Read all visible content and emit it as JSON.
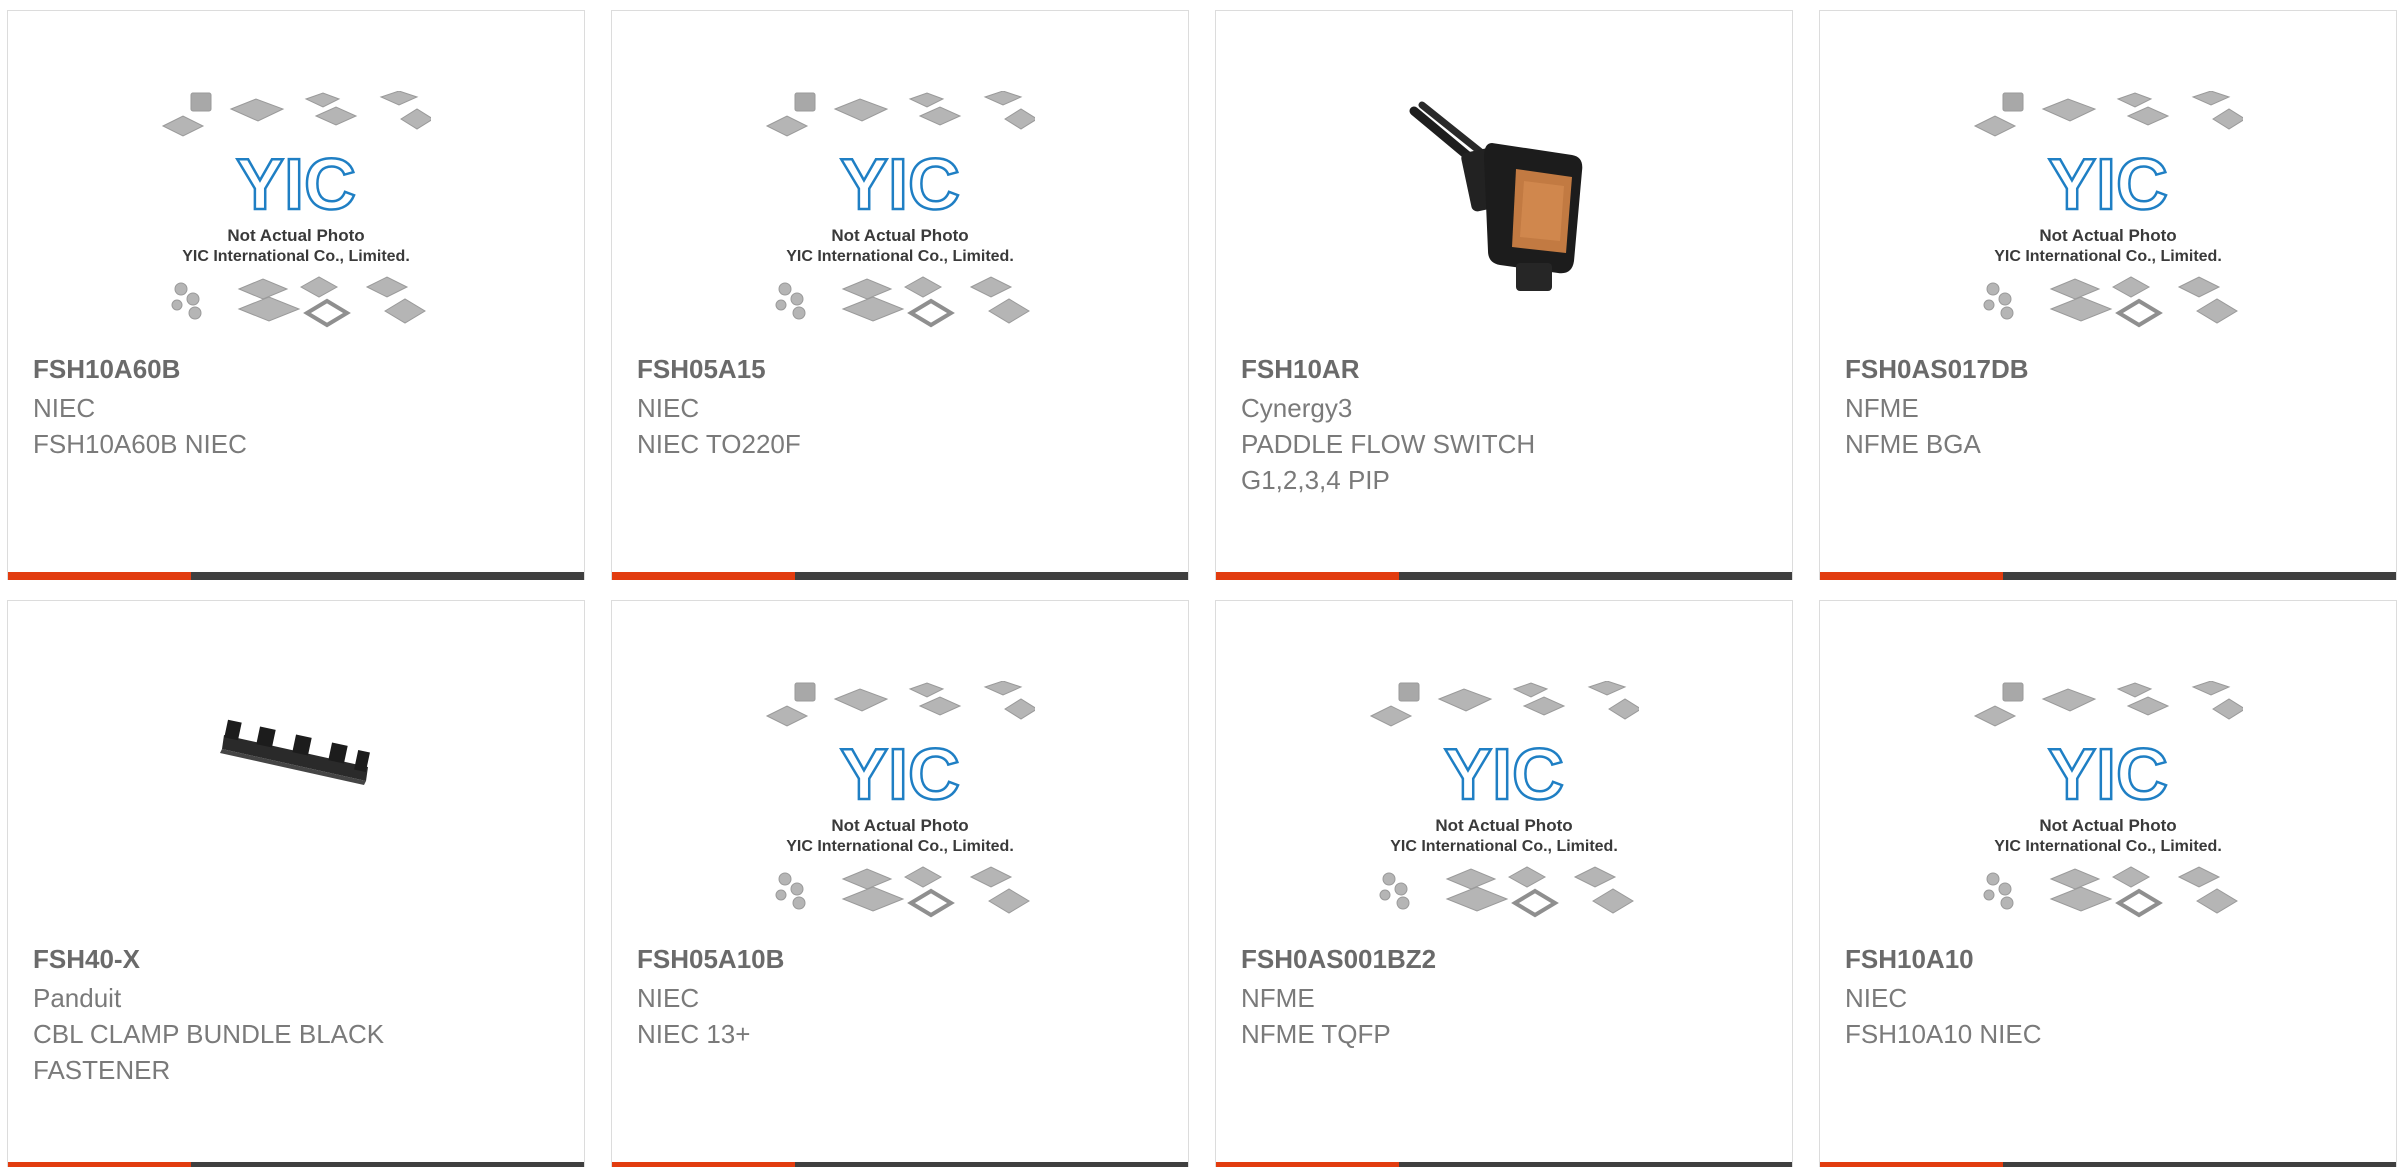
{
  "placeholder": {
    "logo": "YIC",
    "line1": "Not Actual Photo",
    "line2": "YIC International Co., Limited."
  },
  "colors": {
    "accent": "#e23c0f",
    "bar": "#3f3f3f",
    "border": "#dcdcdc",
    "logo": "#1f7fc4"
  },
  "products": [
    {
      "part": "FSH10A60B",
      "maker": "NIEC",
      "desc": [
        "FSH10A60B NIEC"
      ],
      "image": "placeholder"
    },
    {
      "part": "FSH05A15",
      "maker": "NIEC",
      "desc": [
        "NIEC TO220F"
      ],
      "image": "placeholder"
    },
    {
      "part": "FSH10AR",
      "maker": "Cynergy3",
      "desc": [
        "PADDLE FLOW SWITCH",
        "G1,2,3,4 PIP"
      ],
      "image": "flow-switch-photo"
    },
    {
      "part": "FSH0AS017DB",
      "maker": "NFME",
      "desc": [
        "NFME BGA"
      ],
      "image": "placeholder"
    },
    {
      "part": "FSH40-X",
      "maker": "Panduit",
      "desc": [
        "CBL CLAMP BUNDLE BLACK",
        "FASTENER"
      ],
      "image": "cable-clamp-photo"
    },
    {
      "part": "FSH05A10B",
      "maker": "NIEC",
      "desc": [
        "NIEC 13+"
      ],
      "image": "placeholder"
    },
    {
      "part": "FSH0AS001BZ2",
      "maker": "NFME",
      "desc": [
        "NFME TQFP"
      ],
      "image": "placeholder"
    },
    {
      "part": "FSH10A10",
      "maker": "NIEC",
      "desc": [
        "FSH10A10 NIEC"
      ],
      "image": "placeholder"
    }
  ]
}
